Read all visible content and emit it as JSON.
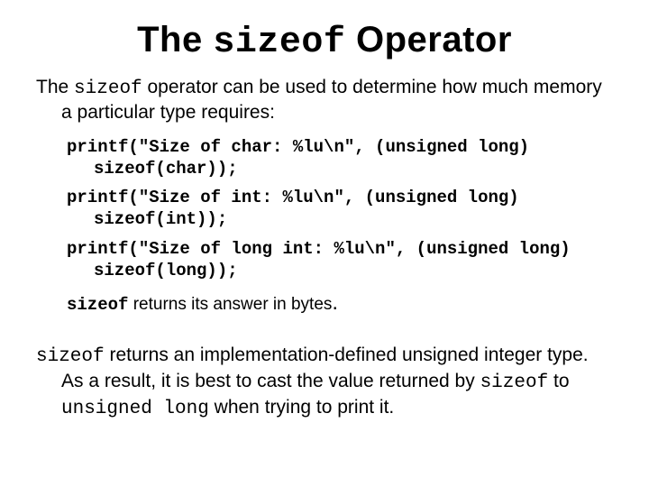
{
  "title": {
    "pre": "The ",
    "code": "sizeof",
    "post": " Operator"
  },
  "intro": {
    "pre": "The ",
    "code": "sizeof",
    "post": " operator can be used to determine how much memory a particular type requires:"
  },
  "code": {
    "line1": "printf(\"Size of char: %lu\\n\", (unsigned long) sizeof(char));",
    "line2": "printf(\"Size of int: %lu\\n\", (unsigned long) sizeof(int));",
    "line3": "printf(\"Size of long int: %lu\\n\", (unsigned long) sizeof(long));"
  },
  "note": {
    "code": "sizeof",
    "post_a": " returns its answer in bytes",
    "dot": "."
  },
  "closing": {
    "code1": "sizeof",
    "t1": " returns an implementation-defined unsigned integer type. As a result, it is best to cast the value returned by ",
    "code2": "sizeof",
    "t2": " to ",
    "code3": "unsigned long",
    "t3": " when trying to print it."
  }
}
